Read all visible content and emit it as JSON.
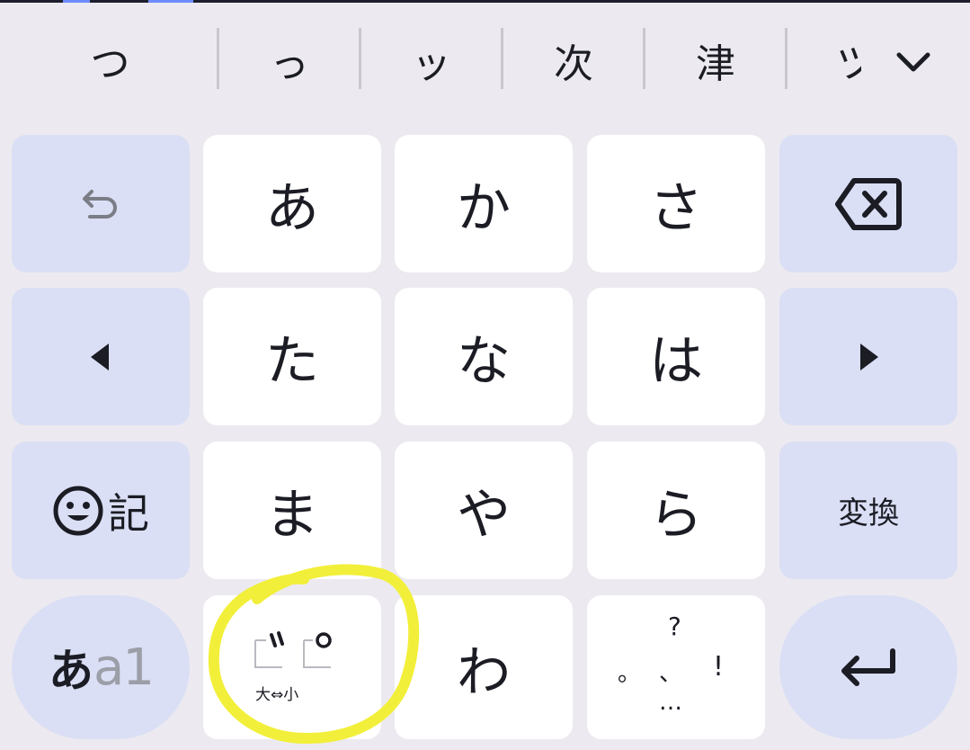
{
  "suggestions": {
    "items": [
      "つ",
      "っ",
      "ッ",
      "次",
      "津",
      "ツ"
    ],
    "expand_icon": "chevron-down-icon"
  },
  "keys": {
    "undo_icon": "undo-icon",
    "a": "あ",
    "ka": "か",
    "sa": "さ",
    "backspace_icon": "backspace-icon",
    "left_icon": "left-arrow-icon",
    "ta": "た",
    "na": "な",
    "ha": "は",
    "right_icon": "right-arrow-icon",
    "emoji_symbol": "記",
    "ma": "ま",
    "ya": "や",
    "ra": "ら",
    "convert": "変換",
    "mode_kana": "あ",
    "mode_alpha": "a1",
    "dakuten_bottom": "大⇔小",
    "wa": "わ",
    "punct_question": "?",
    "punct_exclaim": "!",
    "punct_ellipsis": "…",
    "punct_period": "。",
    "punct_comma": "、",
    "enter_icon": "enter-icon"
  },
  "colors": {
    "background": "#eceaf0",
    "key_white": "#ffffff",
    "key_blue": "#dadff5",
    "text": "#1b1c24",
    "highlight": "#f2ef3a"
  }
}
